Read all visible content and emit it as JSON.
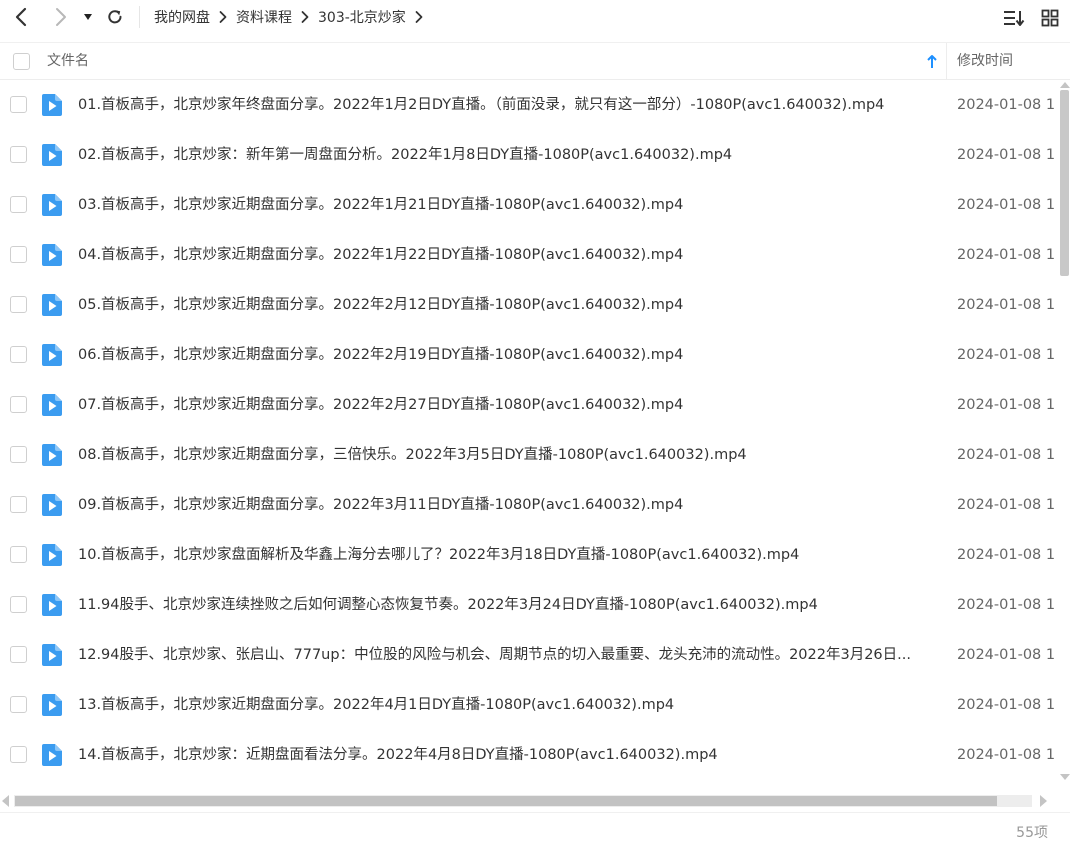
{
  "toolbar": {
    "back_icon": "chevron-left-icon",
    "forward_icon": "chevron-right-icon",
    "history_icon": "caret-down-icon",
    "refresh_icon": "refresh-icon",
    "sort_icon": "sort-list-icon",
    "grid_icon": "grid-view-icon"
  },
  "breadcrumb": {
    "items": [
      "我的网盘",
      "资料课程",
      "303-北京炒家"
    ],
    "separator_icon": "chevron-right-icon"
  },
  "header": {
    "name_label": "文件名",
    "time_label": "修改时间",
    "sort_icon": "arrow-up-icon"
  },
  "files": [
    {
      "name": "01.首板高手，北京炒家年终盘面分享。2022年1月2日DY直播。（前面没录，就只有这一部分）-1080P(avc1.640032).mp4",
      "time": "2024-01-08 1"
    },
    {
      "name": "02.首板高手，北京炒家：新年第一周盘面分析。2022年1月8日DY直播-1080P(avc1.640032).mp4",
      "time": "2024-01-08 1"
    },
    {
      "name": "03.首板高手，北京炒家近期盘面分享。2022年1月21日DY直播-1080P(avc1.640032).mp4",
      "time": "2024-01-08 1"
    },
    {
      "name": "04.首板高手，北京炒家近期盘面分享。2022年1月22日DY直播-1080P(avc1.640032).mp4",
      "time": "2024-01-08 1"
    },
    {
      "name": "05.首板高手，北京炒家近期盘面分享。2022年2月12日DY直播-1080P(avc1.640032).mp4",
      "time": "2024-01-08 1"
    },
    {
      "name": "06.首板高手，北京炒家近期盘面分享。2022年2月19日DY直播-1080P(avc1.640032).mp4",
      "time": "2024-01-08 1"
    },
    {
      "name": "07.首板高手，北京炒家近期盘面分享。2022年2月27日DY直播-1080P(avc1.640032).mp4",
      "time": "2024-01-08 1"
    },
    {
      "name": "08.首板高手，北京炒家近期盘面分享，三倍快乐。2022年3月5日DY直播-1080P(avc1.640032).mp4",
      "time": "2024-01-08 1"
    },
    {
      "name": "09.首板高手，北京炒家近期盘面分享。2022年3月11日DY直播-1080P(avc1.640032).mp4",
      "time": "2024-01-08 1"
    },
    {
      "name": "10.首板高手，北京炒家盘面解析及华鑫上海分去哪儿了？2022年3月18日DY直播-1080P(avc1.640032).mp4",
      "time": "2024-01-08 1"
    },
    {
      "name": "11.94股手、北京炒家连续挫败之后如何调整心态恢复节奏。2022年3月24日DY直播-1080P(avc1.640032).mp4",
      "time": "2024-01-08 1"
    },
    {
      "name": "12.94股手、北京炒家、张启山、777up：中位股的风险与机会、周期节点的切入最重要、龙头充沛的流动性。2022年3月26日...",
      "time": "2024-01-08 1"
    },
    {
      "name": "13.首板高手，北京炒家近期盘面分享。2022年4月1日DY直播-1080P(avc1.640032).mp4",
      "time": "2024-01-08 1"
    },
    {
      "name": "14.首板高手，北京炒家：近期盘面看法分享。2022年4月8日DY直播-1080P(avc1.640032).mp4",
      "time": "2024-01-08 1"
    }
  ],
  "file_icon": "video-file-icon",
  "footer": {
    "count_label": "55项"
  },
  "colors": {
    "video_icon": "#3b9cf0",
    "sort_arrow": "#1e90ff",
    "text": "#333333",
    "muted": "#666666"
  }
}
